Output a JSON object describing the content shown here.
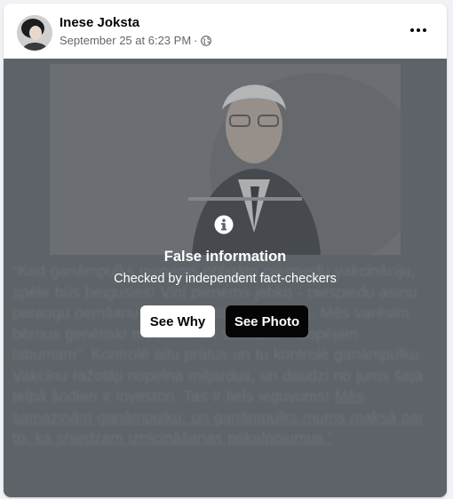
{
  "post": {
    "author": "Inese Joksta",
    "timestamp": "September 25 at 6:23 PM",
    "separator": "·",
    "privacy_icon": "globe-icon",
    "menu_icon": "more-options-icon"
  },
  "fact_check": {
    "icon": "info-icon",
    "title": "False information",
    "subtitle": "Checked by independent fact-checkers",
    "see_why_label": "See Why",
    "see_photo_label": "See Photo"
  },
  "blurred_text": {
    "main": "“Kad ganāmpulks pienems obligāto piespiedu vakcināciju, spēle būs beigusies! Viņi pieņems jebko - piespiedu asiņu paraugu ņemšanu - “kopēja labuma” vārdā. Mēs varēsim bērnus ģenētiski modificēt un sterilizēt - “kopējam labumam”. Kontrolē aitu prātus un tu kontrolē ganāmpulku. Vakcīnu ražotāji nopelna miljardus, un daudzi no jums šajā telpā šodien ir investori. Tas ir liels ieguvums!",
    "underlined": "Mēs samazinām ganāmpulku, un ganāmpulks mums maksā par to, ka sniedzam iznīcināšanas pakalpojumus.”"
  },
  "colors": {
    "overlay": "#62666c",
    "button_dark": "#050505",
    "button_light": "#ffffff"
  }
}
